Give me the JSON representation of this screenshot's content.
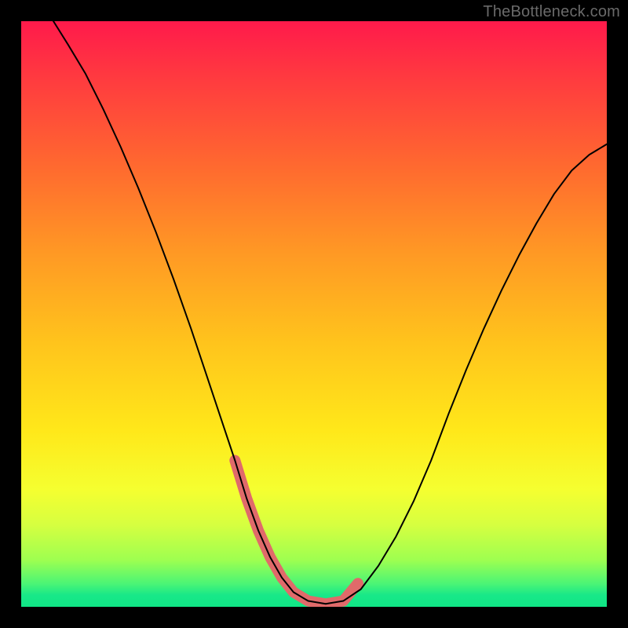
{
  "watermark": "TheBottleneck.com",
  "chart_data": {
    "type": "line",
    "title": "",
    "xlabel": "",
    "ylabel": "",
    "xlim": [
      0,
      1
    ],
    "ylim": [
      0,
      1
    ],
    "background_gradient": {
      "top_color": "#ff1a4b",
      "mid_color": "#ffe81a",
      "bottom_color": "#10e686"
    },
    "series": [
      {
        "name": "main-curve",
        "color": "#000000",
        "stroke_width": 2,
        "x": [
          0.055,
          0.08,
          0.11,
          0.14,
          0.17,
          0.2,
          0.23,
          0.26,
          0.29,
          0.315,
          0.34,
          0.365,
          0.385,
          0.405,
          0.425,
          0.445,
          0.465,
          0.49,
          0.52,
          0.55,
          0.58,
          0.61,
          0.64,
          0.67,
          0.7,
          0.73,
          0.76,
          0.79,
          0.82,
          0.85,
          0.88,
          0.91,
          0.94,
          0.97,
          1.0
        ],
        "y": [
          1.0,
          0.96,
          0.91,
          0.85,
          0.785,
          0.715,
          0.64,
          0.56,
          0.475,
          0.4,
          0.325,
          0.25,
          0.185,
          0.13,
          0.085,
          0.05,
          0.025,
          0.01,
          0.005,
          0.01,
          0.03,
          0.07,
          0.12,
          0.18,
          0.25,
          0.33,
          0.405,
          0.475,
          0.54,
          0.6,
          0.655,
          0.705,
          0.745,
          0.772,
          0.79
        ]
      },
      {
        "name": "highlight-valley",
        "color": "#e06a6a",
        "stroke_width": 14,
        "linecap": "round",
        "x": [
          0.365,
          0.385,
          0.405,
          0.425,
          0.445,
          0.465,
          0.49,
          0.52,
          0.55,
          0.575
        ],
        "y": [
          0.25,
          0.185,
          0.13,
          0.085,
          0.05,
          0.025,
          0.01,
          0.005,
          0.01,
          0.04
        ]
      }
    ]
  }
}
